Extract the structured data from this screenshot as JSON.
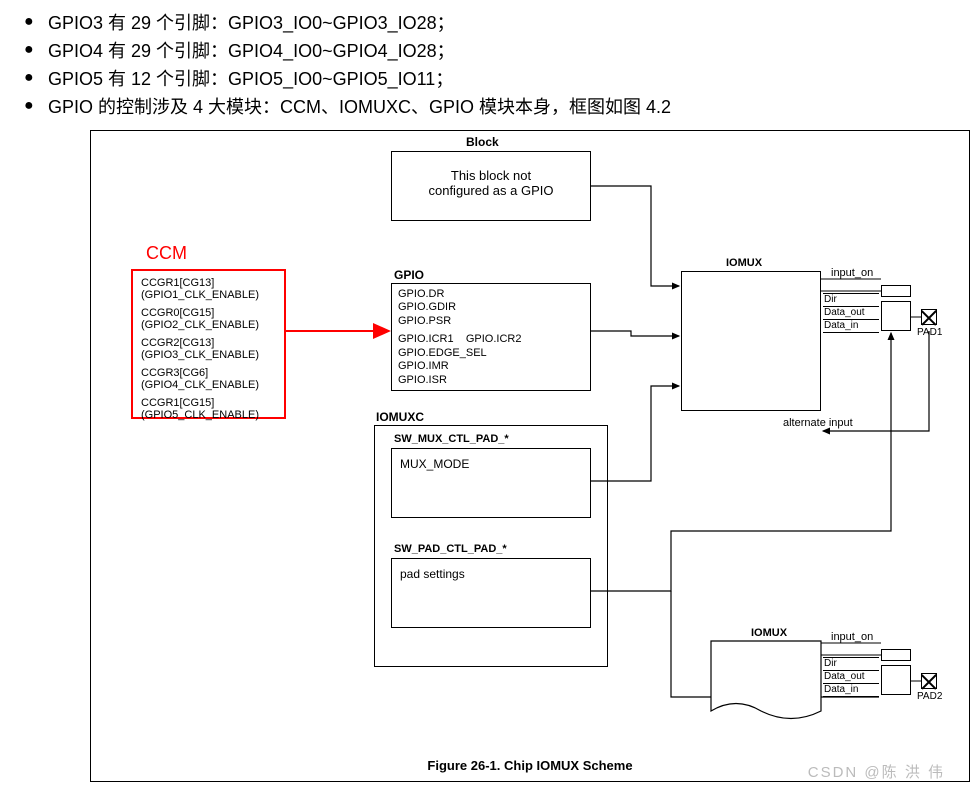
{
  "bullets": {
    "b1": "GPIO3 有 29 个引脚：GPIO3_IO0~GPIO3_IO28；",
    "b2": "GPIO4 有 29 个引脚：GPIO4_IO0~GPIO4_IO28；",
    "b3": "GPIO5 有 12 个引脚：GPIO5_IO0~GPIO5_IO11；",
    "b4": "GPIO 的控制涉及 4 大模块：CCM、IOMUXC、GPIO 模块本身，框图如图 4.2"
  },
  "ccm": {
    "title": "CCM",
    "r1a": "CCGR1[CG13]",
    "r1b": "(GPIO1_CLK_ENABLE)",
    "r2a": "CCGR0[CG15]",
    "r2b": "(GPIO2_CLK_ENABLE)",
    "r3a": "CCGR2[CG13]",
    "r3b": "(GPIO3_CLK_ENABLE)",
    "r4a": "CCGR3[CG6]",
    "r4b": "(GPIO4_CLK_ENABLE)",
    "r5a": "CCGR1[CG15]",
    "r5b": "(GPIO5_CLK_ENABLE)"
  },
  "block": {
    "title": "Block",
    "text1": "This block not",
    "text2": "configured as a GPIO"
  },
  "gpio": {
    "title": "GPIO",
    "l1": "GPIO.DR",
    "l2": "GPIO.GDIR",
    "l3": "GPIO.PSR",
    "l4a": "GPIO.ICR1",
    "l4b": "GPIO.ICR2",
    "l5": "GPIO.EDGE_SEL",
    "l6": "GPIO.IMR",
    "l7": "GPIO.ISR"
  },
  "iomuxc": {
    "title": "IOMUXC",
    "mux_title": "SW_MUX_CTL_PAD_*",
    "mux_field": "MUX_MODE",
    "pad_title": "SW_PAD_CTL_PAD_*",
    "pad_field": "pad settings"
  },
  "iomux": {
    "title": "IOMUX",
    "input_on": "input_on",
    "dir": "Dir",
    "data_out": "Data_out",
    "data_in": "Data_in",
    "alt_input": "alternate input",
    "pad1": "PAD1",
    "pad2": "PAD2"
  },
  "caption": "Figure 26-1. Chip IOMUX Scheme",
  "watermark": "CSDN @陈 洪 伟"
}
